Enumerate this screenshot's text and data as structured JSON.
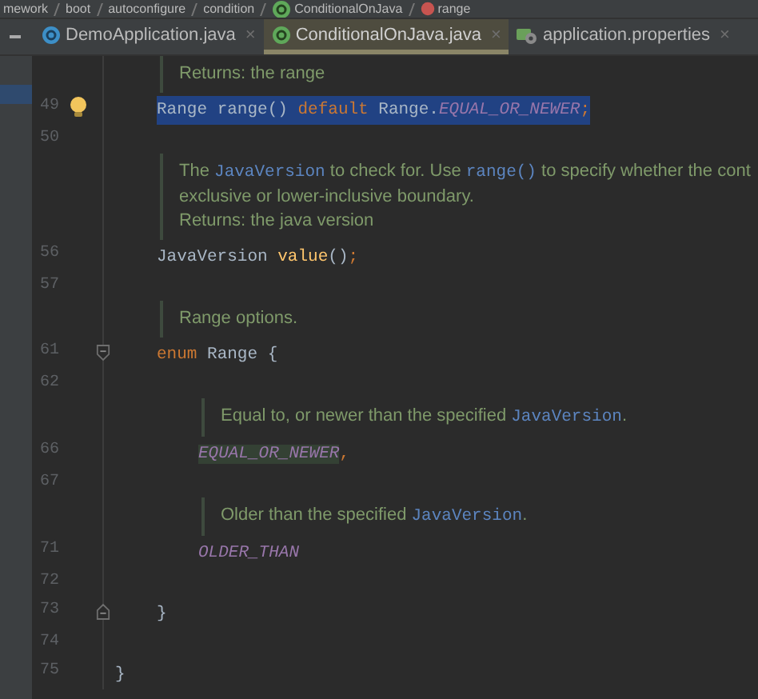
{
  "breadcrumb": [
    {
      "label": "mework",
      "kind": "package"
    },
    {
      "label": "boot",
      "kind": "package"
    },
    {
      "label": "autoconfigure",
      "kind": "package"
    },
    {
      "label": "condition",
      "kind": "package"
    },
    {
      "label": "ConditionalOnJava",
      "kind": "annotation"
    },
    {
      "label": "range",
      "kind": "method"
    }
  ],
  "tabs": [
    {
      "label": "DemoApplication.java",
      "kind": "class",
      "selected": false,
      "close": "×"
    },
    {
      "label": "ConditionalOnJava.java",
      "kind": "annotation",
      "selected": true,
      "close": "×"
    },
    {
      "label": "application.properties",
      "kind": "properties",
      "selected": false,
      "close": "×"
    }
  ],
  "body": [
    {
      "kind": "doc",
      "lines": [
        [
          {
            "kind": "text",
            "text": "Returns: the range"
          }
        ]
      ]
    },
    {
      "kind": "code",
      "number": "49",
      "selected": true,
      "bulb": true,
      "tokens": [
        {
          "kind": "plain",
          "text": "Range "
        },
        {
          "kind": "plain",
          "text": "range() "
        },
        {
          "kind": "keyword",
          "text": "default "
        },
        {
          "kind": "plain",
          "text": "Range."
        },
        {
          "kind": "constant",
          "text": "EQUAL_OR_NEWER"
        },
        {
          "kind": "keyword",
          "text": ";"
        }
      ]
    },
    {
      "kind": "code",
      "number": "50"
    },
    {
      "kind": "doc",
      "lines": [
        [
          {
            "kind": "text",
            "text": "The "
          },
          {
            "kind": "link",
            "text": "JavaVersion"
          },
          {
            "kind": "text",
            "text": " to check for. Use "
          },
          {
            "kind": "link",
            "text": "range()"
          },
          {
            "kind": "text",
            "text": " to specify whether the cont"
          }
        ],
        [
          {
            "kind": "text",
            "text": "exclusive or lower-inclusive boundary."
          }
        ],
        [
          {
            "kind": "text",
            "text": "Returns: the java version"
          }
        ]
      ]
    },
    {
      "kind": "code",
      "number": "56",
      "tokens": [
        {
          "kind": "plain",
          "text": "JavaVersion "
        },
        {
          "kind": "method",
          "text": "value"
        },
        {
          "kind": "plain",
          "text": "()"
        },
        {
          "kind": "keyword",
          "text": ";"
        }
      ]
    },
    {
      "kind": "code",
      "number": "57"
    },
    {
      "kind": "doc",
      "lines": [
        [
          {
            "kind": "text",
            "text": "Range options."
          }
        ]
      ]
    },
    {
      "kind": "fold_start",
      "number": "61",
      "tokens": [
        {
          "kind": "keyword",
          "text": "enum "
        },
        {
          "kind": "plain",
          "text": "Range {"
        }
      ],
      "children": [
        {
          "kind": "code",
          "number": "62"
        },
        {
          "kind": "doc",
          "lines": [
            [
              {
                "kind": "text",
                "text": "Equal to, or newer than the specified "
              },
              {
                "kind": "link",
                "text": "JavaVersion"
              },
              {
                "kind": "text",
                "text": "."
              }
            ]
          ]
        },
        {
          "kind": "code",
          "number": "66",
          "tokens": [
            {
              "kind": "constant",
              "text": "EQUAL_OR_NEWER",
              "highlighted": true
            },
            {
              "kind": "keyword",
              "text": ","
            }
          ]
        },
        {
          "kind": "code",
          "number": "67"
        },
        {
          "kind": "doc",
          "lines": [
            [
              {
                "kind": "text",
                "text": "Older than the specified "
              },
              {
                "kind": "link",
                "text": "JavaVersion"
              },
              {
                "kind": "text",
                "text": "."
              }
            ]
          ]
        },
        {
          "kind": "code",
          "number": "71",
          "tokens": [
            {
              "kind": "constant",
              "text": "OLDER_THAN"
            }
          ]
        },
        {
          "kind": "code",
          "number": "72"
        }
      ]
    },
    {
      "kind": "fold_end",
      "number": "73",
      "tokens": [
        {
          "kind": "plain",
          "text": "}"
        }
      ]
    },
    {
      "kind": "code",
      "number": "74"
    }
  ],
  "closing_line": {
    "number": "75",
    "text": "}"
  }
}
